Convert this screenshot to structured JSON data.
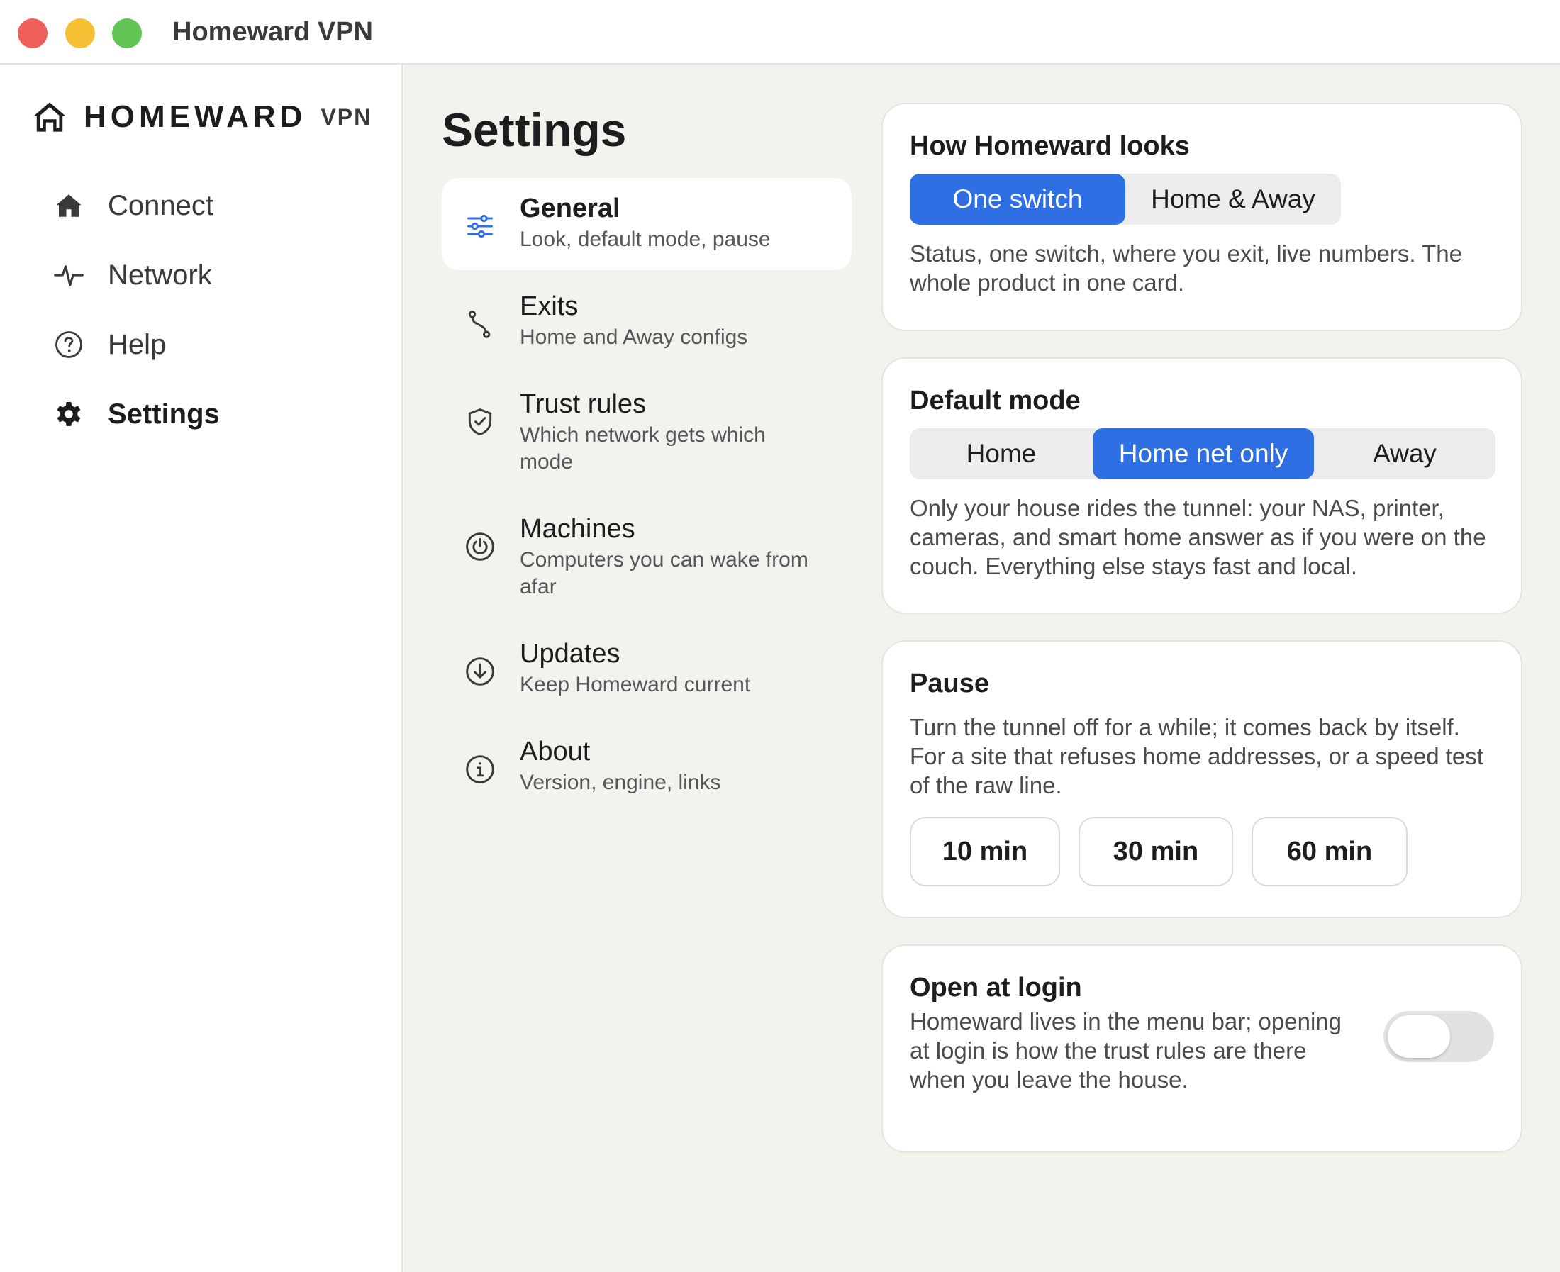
{
  "window": {
    "title": "Homeward VPN",
    "controls": [
      "close",
      "minimize",
      "maximize"
    ]
  },
  "brand": {
    "name": "HOMEWARD",
    "suffix": "VPN",
    "icon": "house-icon"
  },
  "sidebar": {
    "items": [
      {
        "label": "Connect",
        "icon": "house-icon",
        "active": false
      },
      {
        "label": "Network",
        "icon": "pulse-icon",
        "active": false
      },
      {
        "label": "Help",
        "icon": "question-circle-icon",
        "active": false
      },
      {
        "label": "Settings",
        "icon": "gear-icon",
        "active": true
      }
    ]
  },
  "page": {
    "title": "Settings"
  },
  "settings_nav": {
    "items": [
      {
        "title": "General",
        "desc": "Look, default mode, pause",
        "icon": "sliders-icon",
        "active": true
      },
      {
        "title": "Exits",
        "desc": "Home and Away configs",
        "icon": "route-icon",
        "active": false
      },
      {
        "title": "Trust rules",
        "desc": "Which network gets which mode",
        "icon": "shield-check-icon",
        "active": false
      },
      {
        "title": "Machines",
        "desc": "Computers you can wake from afar",
        "icon": "power-icon",
        "active": false
      },
      {
        "title": "Updates",
        "desc": "Keep Homeward current",
        "icon": "download-circle-icon",
        "active": false
      },
      {
        "title": "About",
        "desc": "Version, engine, links",
        "icon": "info-circle-icon",
        "active": false
      }
    ]
  },
  "cards": {
    "looks": {
      "title": "How Homeward looks",
      "options": [
        "One switch",
        "Home & Away"
      ],
      "selected": "One switch",
      "body": "Status, one switch, where you exit, live numbers. The whole product in one card."
    },
    "default_mode": {
      "title": "Default mode",
      "options": [
        "Home",
        "Home net only",
        "Away"
      ],
      "selected": "Home net only",
      "body": "Only your house rides the tunnel: your NAS, printer, cameras, and smart home answer as if you were on the couch. Everything else stays fast and local."
    },
    "pause": {
      "title": "Pause",
      "body": "Turn the tunnel off for a while; it comes back by itself. For a site that refuses home addresses, or a speed test of the raw line.",
      "buttons": [
        "10 min",
        "30 min",
        "60 min"
      ]
    },
    "login": {
      "title": "Open at login",
      "body": "Homeward lives in the menu bar; opening at login is how the trust rules are there when you leave the house.",
      "enabled": false
    }
  },
  "colors": {
    "accent": "#2f6fe4",
    "main_background": "#f4f2ec",
    "close": "#ee5f59",
    "minimize": "#f5c033",
    "maximize": "#5fc454"
  }
}
